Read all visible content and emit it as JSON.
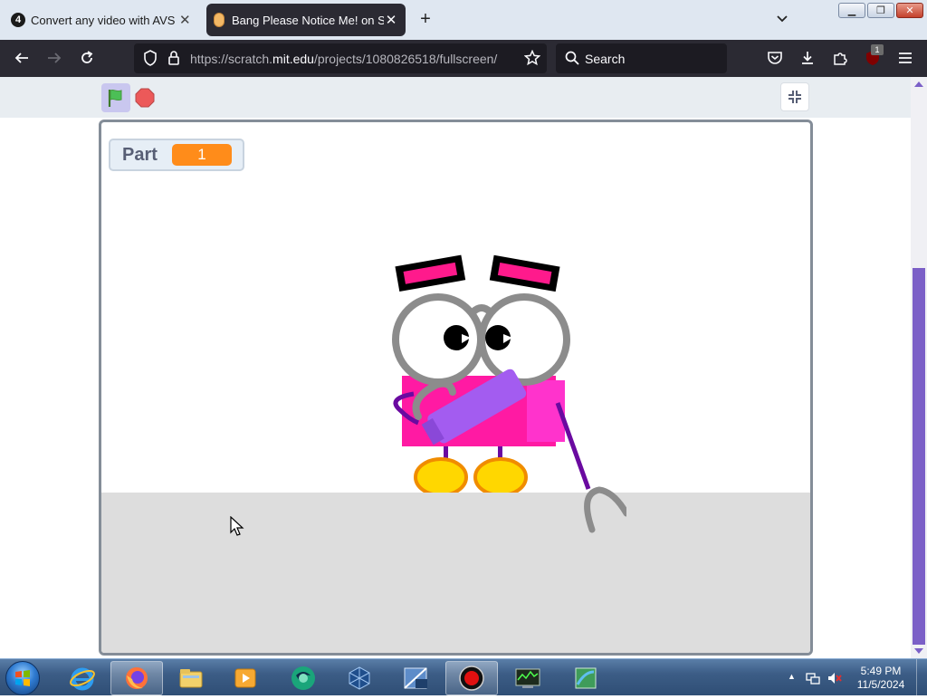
{
  "browser": {
    "tabs": [
      {
        "icon": "avs-video-converter-favicon",
        "badge": "4",
        "title": "Convert any video with AVS Free",
        "active": false
      },
      {
        "icon": "scratch-favicon",
        "title": "Bang Please Notice Me! on Scratch",
        "active": true
      }
    ],
    "url": {
      "prefix": "https://scratch.",
      "domain": "mit.edu",
      "path": "/projects/1080826518/fullscreen/"
    },
    "search_label": "Search",
    "extension_badge": "1"
  },
  "scratch": {
    "variable_monitor": {
      "name": "Part",
      "value": "1"
    },
    "colors": {
      "monitor_value": "#ff8c1a",
      "flag_active_bg": "#c9c7ef",
      "stage_border": "#848d98",
      "floor": "#dddddd"
    }
  },
  "taskbar": {
    "pinned": [
      "internet-explorer-icon",
      "firefox-icon",
      "windows-explorer-icon",
      "media-player-icon",
      "avs-converter-icon",
      "virtualbox-icon",
      "xp-mode-icon",
      "screen-recorder-icon",
      "task-manager-icon",
      "maps-app-icon"
    ],
    "clock": {
      "time": "5:49 PM",
      "date": "11/5/2024"
    }
  }
}
